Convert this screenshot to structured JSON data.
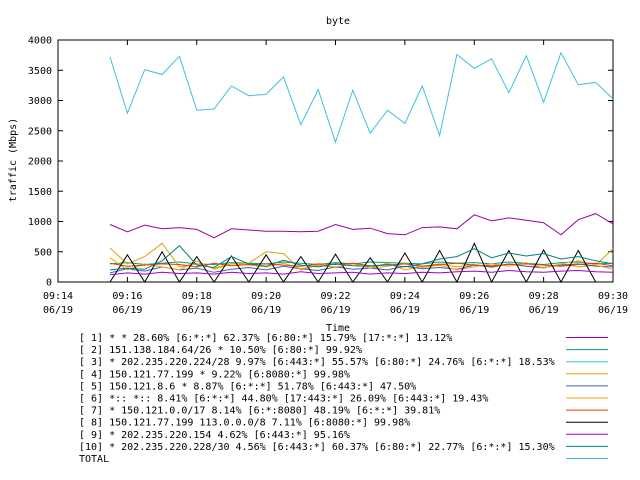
{
  "chart_data": {
    "type": "line",
    "title": "byte",
    "xlabel": "Time",
    "ylabel": "traffic (Mbps)",
    "ylim": [
      0,
      4000
    ],
    "xlim": [
      0,
      16
    ],
    "y_ticks": [
      0,
      500,
      1000,
      1500,
      2000,
      2500,
      3000,
      3500,
      4000
    ],
    "x_ticks": [
      {
        "x": 0,
        "time": "09:14",
        "date": "06/19"
      },
      {
        "x": 2,
        "time": "09:16",
        "date": "06/19"
      },
      {
        "x": 4,
        "time": "09:18",
        "date": "06/19"
      },
      {
        "x": 6,
        "time": "09:20",
        "date": "06/19"
      },
      {
        "x": 8,
        "time": "09:22",
        "date": "06/19"
      },
      {
        "x": 10,
        "time": "09:24",
        "date": "06/19"
      },
      {
        "x": 12,
        "time": "09:26",
        "date": "06/19"
      },
      {
        "x": 14,
        "time": "09:28",
        "date": "06/19"
      },
      {
        "x": 16,
        "time": "09:30",
        "date": "06/19"
      }
    ],
    "x": [
      1.5,
      2,
      2.5,
      3,
      3.5,
      4,
      4.5,
      5,
      5.5,
      6,
      6.5,
      7,
      7.5,
      8,
      8.5,
      9,
      9.5,
      10,
      10.5,
      11,
      11.5,
      12,
      12.5,
      13,
      13.5,
      14,
      14.5,
      15,
      15.5,
      16
    ],
    "grid": false,
    "legend_position": "bottom",
    "series": [
      {
        "name": "[ 1] * * 28.60%  [6:*:*] 62.37% [6:80:*] 15.79% [17:*:*] 13.12%",
        "color": "#a000a0",
        "values": [
          950,
          830,
          940,
          880,
          900,
          870,
          730,
          880,
          860,
          840,
          840,
          830,
          840,
          950,
          870,
          890,
          800,
          780,
          900,
          910,
          880,
          1110,
          1010,
          1060,
          1020,
          980,
          780,
          1030,
          1130,
          960
        ]
      },
      {
        "name": "[ 2] 151.138.184.64/26 * 10.50%  [6:80:*] 99.92%",
        "color": "#00a080",
        "values": [
          300,
          320,
          290,
          310,
          330,
          300,
          290,
          320,
          310,
          300,
          330,
          310,
          290,
          320,
          300,
          330,
          320,
          310,
          300,
          330,
          310,
          320,
          300,
          330,
          310,
          290,
          320,
          330,
          300,
          310
        ]
      },
      {
        "name": "[ 3] * 202.235.220.224/28 9.97%  [6:443:*] 55.57% [6:80:*] 24.76% [6:*:*] 18.53%",
        "color": "#40c0e0",
        "values": [
          3720,
          2790,
          3510,
          3430,
          3730,
          2840,
          2860,
          3240,
          3080,
          3100,
          3390,
          2600,
          3180,
          2310,
          3170,
          2460,
          2840,
          2620,
          3240,
          2420,
          3760,
          3530,
          3690,
          3130,
          3740,
          2970,
          3790,
          3260,
          3300,
          3030
        ]
      },
      {
        "name": "[ 4] 150.121.77.199 * 9.22%  [6:8080:*] 99.98%",
        "color": "#e0a000",
        "values": [
          560,
          300,
          420,
          640,
          250,
          300,
          230,
          300,
          310,
          500,
          470,
          200,
          290,
          240,
          300,
          230,
          310,
          200,
          260,
          300,
          250,
          290,
          240,
          300,
          260,
          230,
          300,
          250,
          280,
          550
        ]
      },
      {
        "name": "[ 5] 150.121.8.6 * 8.87%  [6:*:*] 51.78% [6:443:*] 47.50%",
        "color": "#4060c0",
        "values": [
          150,
          220,
          180,
          250,
          200,
          230,
          160,
          210,
          240,
          200,
          260,
          220,
          190,
          250,
          210,
          230,
          200,
          260,
          220,
          240,
          210,
          280,
          250,
          300,
          260,
          240,
          280,
          300,
          260,
          250
        ]
      },
      {
        "name": "[ 6] *:: *:: 8.41%  [6:*:*] 44.80% [17:443:*] 26.09% [6:443:*] 19.43%",
        "color": "#ffa000",
        "values": [
          400,
          200,
          300,
          250,
          200,
          350,
          210,
          300,
          280,
          250,
          310,
          220,
          270,
          250,
          300,
          230,
          260,
          310,
          240,
          280,
          200,
          250,
          300,
          260,
          320,
          230,
          300,
          350,
          280,
          210
        ]
      },
      {
        "name": "[ 7] * 150.121.0.0/17 8.14%  [6:*:8080] 48.19% [6:*:*] 39.81%",
        "color": "#e04000",
        "values": [
          310,
          260,
          280,
          300,
          290,
          250,
          310,
          270,
          290,
          300,
          280,
          260,
          300,
          290,
          310,
          270,
          280,
          300,
          260,
          290,
          310,
          280,
          270,
          290,
          300,
          280,
          260,
          290,
          310,
          270
        ]
      },
      {
        "name": "[ 8] 150.121.77.199 113.0.0.0/8 7.11%  [6:8080:*] 99.98%",
        "color": "#000000",
        "values": [
          0,
          450,
          0,
          500,
          0,
          420,
          0,
          430,
          0,
          450,
          0,
          420,
          0,
          460,
          0,
          400,
          0,
          480,
          0,
          520,
          0,
          640,
          0,
          520,
          0,
          530,
          0,
          520,
          0,
          0
        ]
      },
      {
        "name": "[ 9] * 202.235.220.154 4.62%  [6:443:*] 95.16%",
        "color": "#a000c0",
        "values": [
          120,
          150,
          130,
          160,
          140,
          150,
          130,
          160,
          140,
          150,
          130,
          170,
          140,
          150,
          160,
          130,
          150,
          140,
          160,
          150,
          170,
          180,
          160,
          190,
          170,
          160,
          180,
          190,
          170,
          160
        ]
      },
      {
        "name": "[10] * 202.235.220.228/30 4.56%  [6:443:*] 60.37% [6:80:*] 22.77% [6:*:*] 15.30%",
        "color": "#008080",
        "values": [
          200,
          230,
          210,
          350,
          600,
          280,
          240,
          420,
          300,
          260,
          360,
          280,
          250,
          300,
          270,
          260,
          290,
          250,
          300,
          380,
          420,
          550,
          400,
          480,
          430,
          470,
          380,
          420,
          350,
          300
        ]
      }
    ],
    "total_label": "TOTAL",
    "total_color": "#40c0e0"
  }
}
